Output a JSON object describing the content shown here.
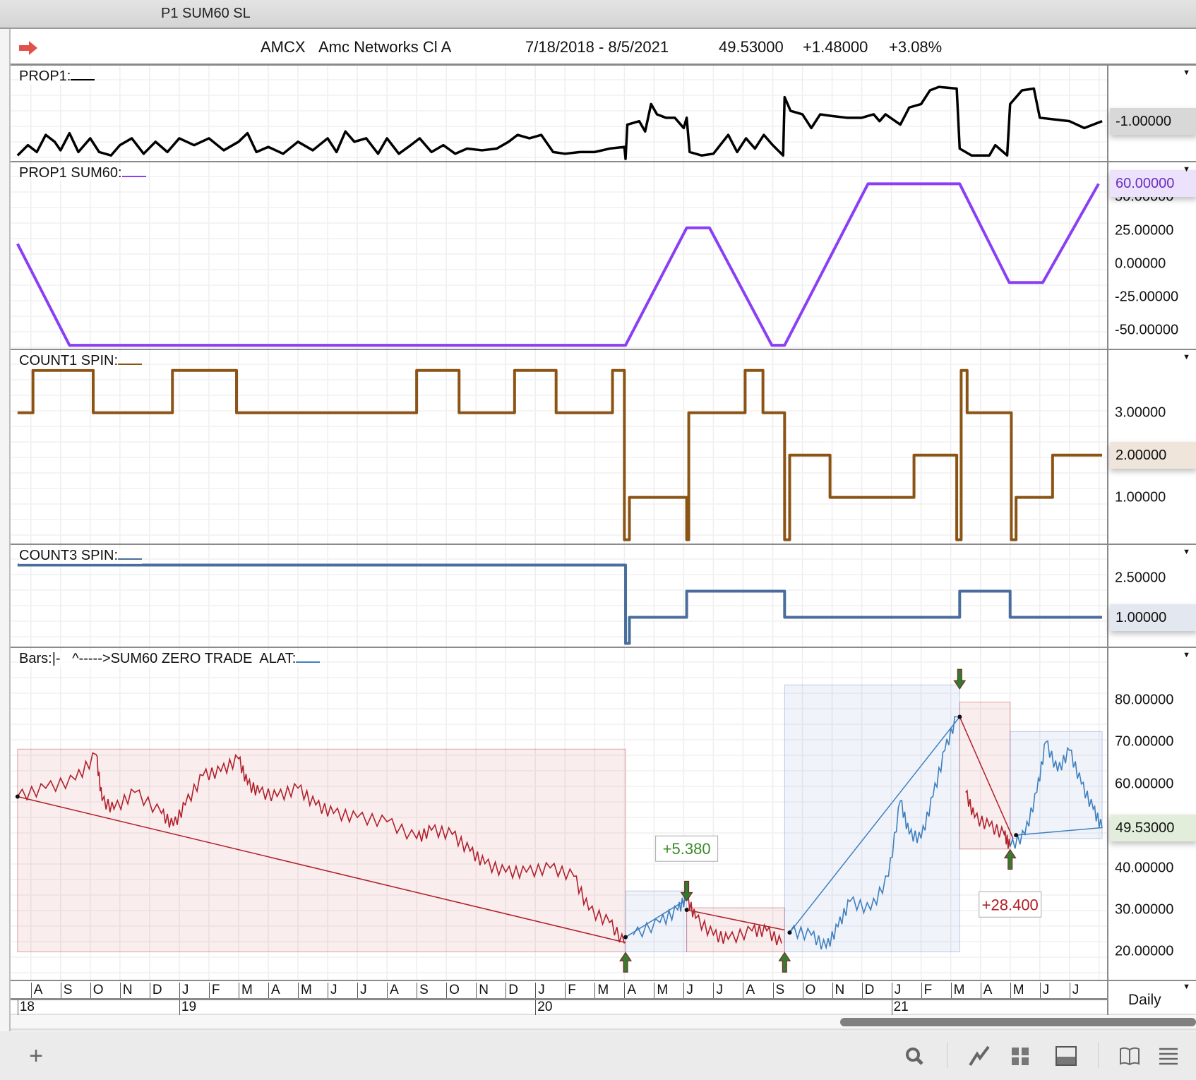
{
  "window": {
    "title": "P1 SUM60 SL"
  },
  "header": {
    "symbol": "AMCX",
    "name": "Amc Networks Cl A",
    "range": "7/18/2018 - 8/5/2021",
    "last": "49.53000",
    "change": "+1.48000",
    "pct": "+3.08%"
  },
  "colors": {
    "prop1": "#000000",
    "sum60": "#8a3ff5",
    "count1": "#8b5415",
    "count3": "#4a6e9c",
    "down": "#b0202a",
    "up": "#3f7fbf",
    "profit": "#3a8a2a"
  },
  "chart_data": [
    {
      "type": "line",
      "title": "PROP1:",
      "ylim": [
        -2.16,
        0.62
      ],
      "ticks": [],
      "current": {
        "label": "-1.00000",
        "value": -1.0
      },
      "points": [
        [
          0.55,
          -2.0
        ],
        [
          0.9,
          -1.7
        ],
        [
          1.2,
          -1.9
        ],
        [
          1.5,
          -1.4
        ],
        [
          1.8,
          -1.6
        ],
        [
          2.0,
          -1.85
        ],
        [
          2.3,
          -1.35
        ],
        [
          2.6,
          -1.9
        ],
        [
          3.0,
          -1.5
        ],
        [
          3.3,
          -1.9
        ],
        [
          3.7,
          -2.0
        ],
        [
          4.0,
          -1.7
        ],
        [
          4.4,
          -1.5
        ],
        [
          4.8,
          -1.95
        ],
        [
          5.2,
          -1.6
        ],
        [
          5.6,
          -1.9
        ],
        [
          6.0,
          -1.5
        ],
        [
          6.5,
          -1.7
        ],
        [
          7.0,
          -1.5
        ],
        [
          7.5,
          -1.85
        ],
        [
          8.0,
          -1.6
        ],
        [
          8.3,
          -1.35
        ],
        [
          8.6,
          -1.9
        ],
        [
          9.0,
          -1.75
        ],
        [
          9.5,
          -1.95
        ],
        [
          10.0,
          -1.6
        ],
        [
          10.5,
          -1.85
        ],
        [
          11.0,
          -1.5
        ],
        [
          11.3,
          -1.9
        ],
        [
          11.6,
          -1.3
        ],
        [
          11.9,
          -1.6
        ],
        [
          12.3,
          -1.5
        ],
        [
          12.7,
          -1.95
        ],
        [
          13.0,
          -1.5
        ],
        [
          13.4,
          -1.95
        ],
        [
          13.8,
          -1.7
        ],
        [
          14.1,
          -1.5
        ],
        [
          14.5,
          -1.9
        ],
        [
          14.9,
          -1.7
        ],
        [
          15.3,
          -1.95
        ],
        [
          15.7,
          -1.8
        ],
        [
          16.2,
          -1.85
        ],
        [
          16.7,
          -1.8
        ],
        [
          17.1,
          -1.6
        ],
        [
          17.4,
          -1.4
        ],
        [
          17.8,
          -1.5
        ],
        [
          18.2,
          -1.4
        ],
        [
          18.6,
          -1.9
        ],
        [
          19.0,
          -1.95
        ],
        [
          19.5,
          -1.9
        ],
        [
          20.0,
          -1.9
        ],
        [
          20.5,
          -1.8
        ],
        [
          21.0,
          -1.75
        ],
        [
          21.04,
          -2.1
        ],
        [
          21.1,
          -1.1
        ],
        [
          21.5,
          -1.0
        ],
        [
          21.7,
          -1.3
        ],
        [
          21.9,
          -0.5
        ],
        [
          22.1,
          -0.8
        ],
        [
          22.4,
          -0.9
        ],
        [
          22.7,
          -0.9
        ],
        [
          23.0,
          -1.2
        ],
        [
          23.1,
          -0.9
        ],
        [
          23.2,
          -1.9
        ],
        [
          23.6,
          -2.0
        ],
        [
          24.0,
          -1.95
        ],
        [
          24.5,
          -1.4
        ],
        [
          24.8,
          -1.9
        ],
        [
          25.1,
          -1.5
        ],
        [
          25.4,
          -1.8
        ],
        [
          25.7,
          -1.4
        ],
        [
          26.0,
          -1.7
        ],
        [
          26.35,
          -2.0
        ],
        [
          26.4,
          -0.3
        ],
        [
          26.6,
          -0.7
        ],
        [
          27.0,
          -0.8
        ],
        [
          27.3,
          -1.2
        ],
        [
          27.6,
          -0.8
        ],
        [
          28.0,
          -0.85
        ],
        [
          28.5,
          -0.9
        ],
        [
          29.0,
          -0.9
        ],
        [
          29.4,
          -0.8
        ],
        [
          29.6,
          -1.0
        ],
        [
          29.8,
          -0.8
        ],
        [
          30.3,
          -1.1
        ],
        [
          30.6,
          -0.6
        ],
        [
          31.0,
          -0.5
        ],
        [
          31.3,
          -0.1
        ],
        [
          31.6,
          0.0
        ],
        [
          32.2,
          -0.05
        ],
        [
          32.3,
          -1.8
        ],
        [
          32.7,
          -2.0
        ],
        [
          33.3,
          -2.0
        ],
        [
          33.5,
          -1.7
        ],
        [
          33.9,
          -2.0
        ],
        [
          34.0,
          -0.5
        ],
        [
          34.4,
          -0.1
        ],
        [
          34.8,
          -0.05
        ],
        [
          35.0,
          -0.9
        ],
        [
          35.5,
          -0.95
        ],
        [
          36.0,
          -1.0
        ],
        [
          36.5,
          -1.2
        ],
        [
          37.1,
          -1.0
        ]
      ]
    },
    {
      "type": "line",
      "title": "PROP1 SUM60:",
      "ylim": [
        -63.6,
        76.1
      ],
      "ticks": [
        {
          "v": 50,
          "label": "50.00000"
        },
        {
          "v": 25,
          "label": "25.00000"
        },
        {
          "v": 0,
          "label": "0.00000"
        },
        {
          "v": -25,
          "label": "-25.00000"
        },
        {
          "v": -50,
          "label": "-50.00000"
        }
      ],
      "current": {
        "label": "60.00000",
        "value": 60
      },
      "points": [
        [
          0.55,
          15
        ],
        [
          2.3,
          -61
        ],
        [
          21.04,
          -61
        ],
        [
          23.1,
          27
        ],
        [
          23.87,
          27
        ],
        [
          25.97,
          -61
        ],
        [
          26.4,
          -61
        ],
        [
          29.21,
          60
        ],
        [
          32.3,
          60
        ],
        [
          33.97,
          -14
        ],
        [
          35.1,
          -14
        ],
        [
          36.98,
          60
        ]
      ]
    },
    {
      "type": "step",
      "title": "COUNT1 SPIN:",
      "ylim": [
        -0.09,
        4.48
      ],
      "ticks": [
        {
          "v": 3,
          "label": "3.00000"
        },
        {
          "v": 1,
          "label": "1.00000"
        }
      ],
      "current": {
        "label": "2.00000",
        "value": 2
      },
      "points": [
        [
          0.55,
          3
        ],
        [
          1.07,
          4
        ],
        [
          3.1,
          3
        ],
        [
          5.77,
          4
        ],
        [
          7.93,
          3
        ],
        [
          14.0,
          4
        ],
        [
          15.43,
          3
        ],
        [
          17.3,
          4
        ],
        [
          18.7,
          3
        ],
        [
          20.6,
          4
        ],
        [
          21.0,
          0
        ],
        [
          21.17,
          1
        ],
        [
          23.1,
          0
        ],
        [
          23.17,
          3
        ],
        [
          25.07,
          4
        ],
        [
          25.67,
          3
        ],
        [
          26.4,
          0
        ],
        [
          26.57,
          2
        ],
        [
          27.93,
          1
        ],
        [
          30.76,
          2
        ],
        [
          32.2,
          0
        ],
        [
          32.35,
          4
        ],
        [
          32.55,
          3
        ],
        [
          34.04,
          0
        ],
        [
          34.2,
          1
        ],
        [
          35.43,
          2
        ],
        [
          37.1,
          2
        ]
      ]
    },
    {
      "type": "step",
      "title": "COUNT3 SPIN:",
      "ylim": [
        -0.12,
        3.77
      ],
      "ticks": [
        {
          "v": 2.5,
          "label": "2.50000"
        }
      ],
      "current": {
        "label": "1.00000",
        "value": 1
      },
      "points": [
        [
          0.55,
          3
        ],
        [
          21.04,
          0
        ],
        [
          21.17,
          1
        ],
        [
          23.1,
          2
        ],
        [
          26.4,
          1
        ],
        [
          32.3,
          2
        ],
        [
          34.0,
          1
        ],
        [
          37.1,
          1
        ]
      ]
    },
    {
      "type": "line",
      "title": "Bars:",
      "title_rest": "  ^----->SUM60 ZERO TRADE  ALAT:",
      "ylim": [
        13.35,
        92.4
      ],
      "ticks": [
        {
          "v": 80,
          "label": "80.00000"
        },
        {
          "v": 70,
          "label": "70.00000"
        },
        {
          "v": 60,
          "label": "60.00000"
        },
        {
          "v": 40,
          "label": "40.00000"
        },
        {
          "v": 30,
          "label": "30.00000"
        },
        {
          "v": 20,
          "label": "20.00000"
        }
      ],
      "current": {
        "label": "49.53000",
        "value": 49.53
      },
      "points": [
        [
          0.55,
          57
        ],
        [
          1.5,
          59
        ],
        [
          2.5,
          61
        ],
        [
          3.2,
          67
        ],
        [
          3.4,
          56
        ],
        [
          3.8,
          54
        ],
        [
          4.5,
          58
        ],
        [
          5.4,
          53
        ],
        [
          5.8,
          50
        ],
        [
          6.2,
          55
        ],
        [
          6.8,
          62
        ],
        [
          7.4,
          63
        ],
        [
          8.0,
          66
        ],
        [
          8.3,
          60
        ],
        [
          8.7,
          58
        ],
        [
          9.3,
          57
        ],
        [
          10.0,
          59
        ],
        [
          10.6,
          55
        ],
        [
          11.2,
          53
        ],
        [
          12,
          52
        ],
        [
          13,
          51
        ],
        [
          14,
          47
        ],
        [
          14.5,
          49
        ],
        [
          15.2,
          48
        ],
        [
          15.8,
          44
        ],
        [
          16.3,
          41
        ],
        [
          17,
          39
        ],
        [
          17.7,
          39
        ],
        [
          18.5,
          40
        ],
        [
          19.3,
          38
        ],
        [
          19.8,
          30
        ],
        [
          20.5,
          27
        ],
        [
          21,
          22
        ],
        [
          21.3,
          24
        ],
        [
          22.2,
          27
        ],
        [
          22.8,
          30
        ],
        [
          23.1,
          33
        ],
        [
          23.4,
          28
        ],
        [
          24,
          24
        ],
        [
          24.5,
          23
        ],
        [
          25.3,
          25
        ],
        [
          25.8,
          25
        ],
        [
          26.3,
          22
        ],
        [
          26.6,
          25
        ],
        [
          27.3,
          24
        ],
        [
          27.8,
          21
        ],
        [
          28.2,
          26
        ],
        [
          28.6,
          32
        ],
        [
          29.3,
          30
        ],
        [
          29.9,
          38
        ],
        [
          30.3,
          56
        ],
        [
          30.6,
          48
        ],
        [
          31.0,
          47
        ],
        [
          31.4,
          57
        ],
        [
          31.8,
          68
        ],
        [
          32.2,
          76
        ],
        [
          32.5,
          58
        ],
        [
          32.8,
          52
        ],
        [
          33.3,
          50
        ],
        [
          33.8,
          48
        ],
        [
          34.0,
          45
        ],
        [
          34.5,
          48
        ],
        [
          34.9,
          58
        ],
        [
          35.2,
          70
        ],
        [
          35.6,
          63
        ],
        [
          36.0,
          68
        ],
        [
          36.4,
          60
        ],
        [
          36.8,
          54
        ],
        [
          37.1,
          49.5
        ]
      ],
      "trades": [
        {
          "dir": "down",
          "start": 0.55,
          "end": 21.04,
          "box": [
            20,
            68.3
          ],
          "line": [
            [
              0.55,
              57
            ],
            [
              21.04,
              22.2
            ]
          ]
        },
        {
          "dir": "up",
          "start": 21.04,
          "end": 23.1,
          "box": [
            20,
            34.5
          ],
          "line": [
            [
              21.04,
              23.5
            ],
            [
              23.1,
              32.5
            ]
          ],
          "label": "+5.380",
          "label_at": [
            23.1,
            44.6
          ]
        },
        {
          "dir": "down",
          "start": 23.1,
          "end": 26.4,
          "box": [
            20,
            30.5
          ],
          "line": [
            [
              23.1,
              30
            ],
            [
              26.4,
              25.2
            ]
          ]
        },
        {
          "dir": "up",
          "start": 26.4,
          "end": 32.3,
          "box": [
            20,
            83.6
          ],
          "line": [
            [
              26.57,
              24.6
            ],
            [
              32.3,
              76
            ]
          ]
        },
        {
          "dir": "down",
          "start": 32.3,
          "end": 34.0,
          "box": [
            44.5,
            79.5
          ],
          "line": [
            [
              32.3,
              76
            ],
            [
              34.1,
              47
            ]
          ]
        },
        {
          "dir": "up",
          "start": 34.0,
          "end": 37.1,
          "box": [
            47,
            72.5
          ],
          "line": [
            [
              34.2,
              47.8
            ],
            [
              37.1,
              49.6
            ]
          ],
          "label": "+28.400",
          "label_at": [
            34.0,
            31.3
          ]
        }
      ],
      "arrows": [
        {
          "t": 21.04,
          "v": 15.5,
          "dir": "up"
        },
        {
          "t": 26.4,
          "v": 15.5,
          "dir": "up"
        },
        {
          "t": 23.1,
          "v": 36.5,
          "dir": "down"
        },
        {
          "t": 32.3,
          "v": 87,
          "dir": "down"
        },
        {
          "t": 34.0,
          "v": 40,
          "dir": "up"
        }
      ]
    }
  ],
  "time_axis": {
    "months": [
      "A",
      "S",
      "O",
      "N",
      "D",
      "J",
      "F",
      "M",
      "A",
      "M",
      "J",
      "J",
      "A",
      "S",
      "O",
      "N",
      "D",
      "J",
      "F",
      "M",
      "A",
      "M",
      "J",
      "J",
      "A",
      "S",
      "O",
      "N",
      "D",
      "J",
      "F",
      "M",
      "A",
      "M",
      "J",
      "J"
    ],
    "years": [
      {
        "m": 0.55,
        "label": "18"
      },
      {
        "m": 6,
        "label": "19"
      },
      {
        "m": 18,
        "label": "20"
      },
      {
        "m": 30,
        "label": "21"
      }
    ],
    "interval": "Daily"
  },
  "toolbar": {
    "add": "+"
  }
}
